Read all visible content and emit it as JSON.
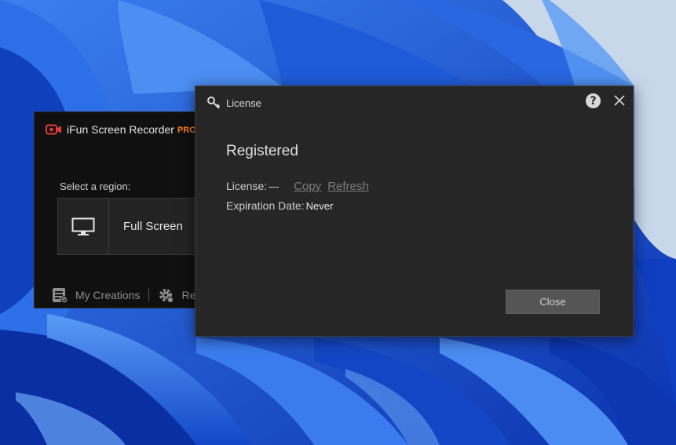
{
  "wallpaper": {
    "colors": {
      "base": "#1d5fd6",
      "light": "#4a8cf0",
      "dark": "#0a2fa3",
      "sky": "#c8d8ea"
    }
  },
  "recorder": {
    "app_name": "iFun Screen Recorder",
    "edition": "PRO",
    "region_label": "Select a region:",
    "region_option": "Full Screen",
    "footer": {
      "my_creations": "My Creations",
      "settings_partial": "Re"
    },
    "colors": {
      "accent": "#ff7a1a",
      "camera_icon": "#e23b3b"
    }
  },
  "license_dialog": {
    "title": "License",
    "heading": "Registered",
    "license_label": "License:",
    "license_value": "---",
    "copy_link": "Copy",
    "refresh_link": "Refresh",
    "expiration_label": "Expiration Date:",
    "expiration_value": "Never",
    "help_glyph": "?",
    "close_button": "Close"
  }
}
